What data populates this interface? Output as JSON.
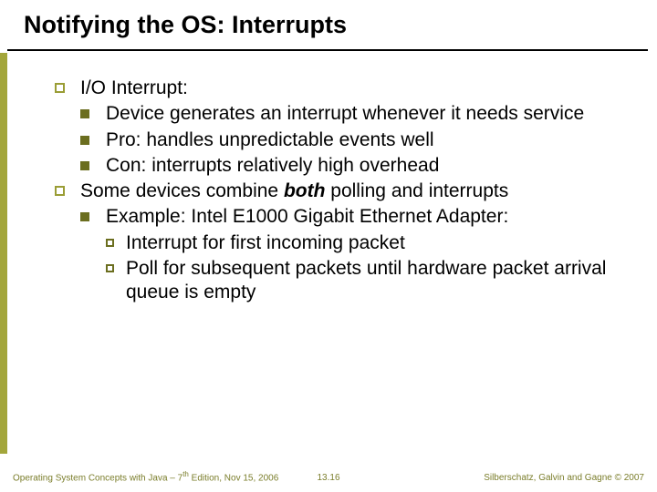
{
  "title": "Notifying the OS: Interrupts",
  "bullets": {
    "b1": "I/O Interrupt:",
    "b1_1": "Device generates an interrupt whenever it needs service",
    "b1_2": "Pro: handles unpredictable events well",
    "b1_3": "Con: interrupts relatively high overhead",
    "b2_pre": "Some devices combine ",
    "b2_bold": "both",
    "b2_post": " polling and interrupts",
    "b2_1": "Example: Intel E1000 Gigabit Ethernet Adapter:",
    "b2_1_1": "Interrupt for first incoming packet",
    "b2_1_2": "Poll for subsequent packets until hardware packet arrival queue is empty"
  },
  "footer": {
    "left_pre": "Operating System Concepts with Java – 7",
    "left_sup": "th",
    "left_post": " Edition, Nov 15, 2006",
    "center": "13.16",
    "right": "Silberschatz, Galvin and Gagne © 2007"
  }
}
